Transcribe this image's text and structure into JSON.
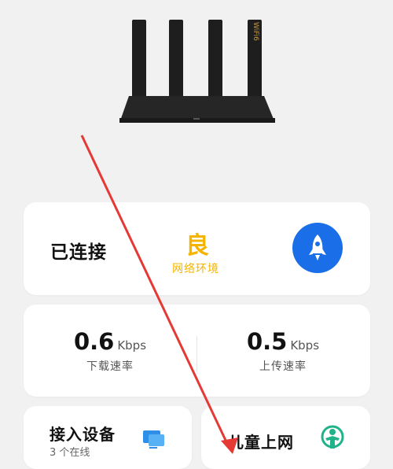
{
  "router": {
    "badge_text": "WiFi6"
  },
  "status": {
    "connection_label": "已连接",
    "quality_grade": "良",
    "quality_desc": "网络环境",
    "boost_icon": "rocket-icon"
  },
  "speed": {
    "download": {
      "value": "0.6",
      "unit": "Kbps",
      "label": "下载速率"
    },
    "upload": {
      "value": "0.5",
      "unit": "Kbps",
      "label": "上传速率"
    }
  },
  "tiles": {
    "devices": {
      "title": "接入设备",
      "sub": "3 个在线",
      "icon": "devices-icon"
    },
    "kids": {
      "title": "儿童上网",
      "icon": "child-icon"
    }
  },
  "colors": {
    "accent_blue": "#1a6fe8",
    "quality_yellow": "#f5b400",
    "kids_green": "#20b38a",
    "annotation_red": "#e53935"
  }
}
